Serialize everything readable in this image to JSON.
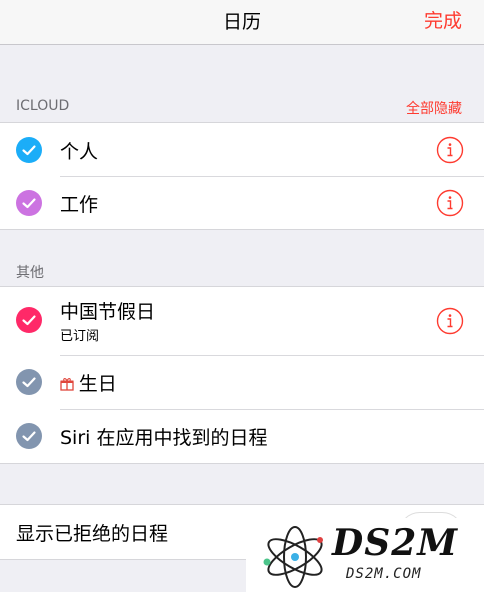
{
  "nav": {
    "title": "日历",
    "done_label": "完成"
  },
  "icloud": {
    "header": "ICLOUD",
    "hide_all_label": "全部隐藏",
    "items": [
      {
        "label": "个人",
        "color": "#1badf8"
      },
      {
        "label": "工作",
        "color": "#cc73e1"
      }
    ]
  },
  "other": {
    "header": "其他",
    "items": [
      {
        "label": "中国节假日",
        "sublabel": "已订阅",
        "color": "#ff2968"
      },
      {
        "label": "生日",
        "color": "#8295af",
        "icon": "gift-icon"
      },
      {
        "label": "Siri 在应用中找到的日程",
        "color": "#8295af"
      }
    ]
  },
  "settings": {
    "show_declined_label": "显示已拒绝的日程"
  },
  "colors": {
    "accent": "#fe3b30"
  },
  "watermark": {
    "brand": "DS2M",
    "site": "DS2M.COM"
  }
}
